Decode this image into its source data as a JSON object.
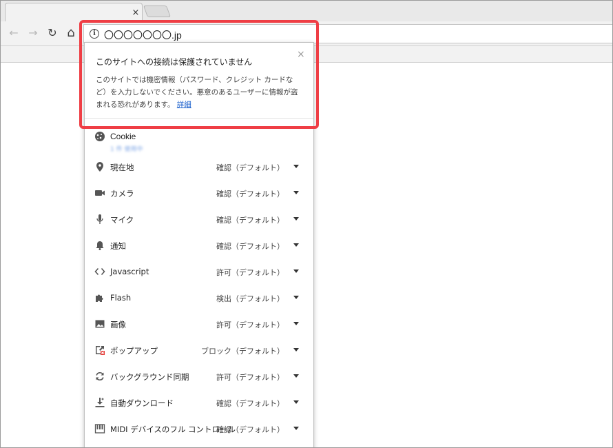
{
  "tabs": {
    "close_glyph": "×"
  },
  "toolbar": {
    "back_icon": "←",
    "forward_icon": "→",
    "reload_icon": "↻",
    "home_icon": "⌂",
    "info_glyph": "i",
    "url": "〇〇〇〇〇〇〇.jp"
  },
  "popup": {
    "title": "このサイトへの接続は保護されていません",
    "close_glyph": "×",
    "description": "このサイトでは機密情報（パスワード、クレジット カードなど）を入力しないでください。悪意のあるユーザーに情報が盗まれる恐れがあります。",
    "details_link": "詳細",
    "cookie": {
      "label": "Cookie",
      "sub": "1 件 使用中"
    },
    "permissions": [
      {
        "id": "location",
        "icon": "location-pin-icon",
        "label": "現在地",
        "value": "確認（デフォルト）"
      },
      {
        "id": "camera",
        "icon": "camera-icon",
        "label": "カメラ",
        "value": "確認（デフォルト）"
      },
      {
        "id": "mic",
        "icon": "microphone-icon",
        "label": "マイク",
        "value": "確認（デフォルト）"
      },
      {
        "id": "notifications",
        "icon": "bell-icon",
        "label": "通知",
        "value": "確認（デフォルト）"
      },
      {
        "id": "javascript",
        "icon": "code-icon",
        "label": "Javascript",
        "value": "許可（デフォルト）"
      },
      {
        "id": "flash",
        "icon": "puzzle-icon",
        "label": "Flash",
        "value": "検出（デフォルト）"
      },
      {
        "id": "images",
        "icon": "image-icon",
        "label": "画像",
        "value": "許可（デフォルト）"
      },
      {
        "id": "popups",
        "icon": "popup-blocked-icon",
        "label": "ポップアップ",
        "value": "ブロック（デフォルト）"
      },
      {
        "id": "background-sync",
        "icon": "sync-icon",
        "label": "バックグラウンド同期",
        "value": "許可（デフォルト）"
      },
      {
        "id": "auto-download",
        "icon": "download-icon",
        "label": "自動ダウンロード",
        "value": "確認（デフォルト）"
      },
      {
        "id": "midi",
        "icon": "piano-keys-icon",
        "label": "MIDI デバイスのフル コントロール",
        "value": "確認（デフォルト）"
      }
    ]
  },
  "colors": {
    "highlight": "#ef3e45",
    "link": "#1a5fcc"
  }
}
